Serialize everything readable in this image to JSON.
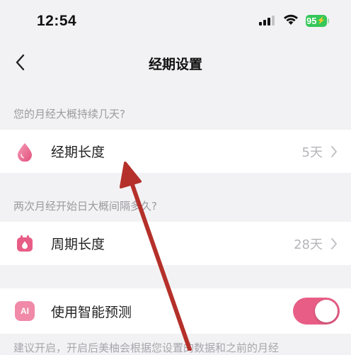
{
  "status_bar": {
    "time": "12:54",
    "battery_level": "95",
    "battery_charging_glyph": "⚡"
  },
  "nav": {
    "title": "经期设置"
  },
  "sections": {
    "period_question": "您的月经大概持续几天?",
    "cycle_question": "两次月经开始日大概间隔多久?",
    "footer_note": "建议开启，开启后美柚会根据您设置的数据和之前的月经"
  },
  "rows": {
    "period_length": {
      "label": "经期长度",
      "value": "5天"
    },
    "cycle_length": {
      "label": "周期长度",
      "value": "28天"
    },
    "smart_prediction": {
      "label": "使用智能预测",
      "icon_text": "AI",
      "enabled": true
    }
  },
  "colors": {
    "accent_pink": "#e85d86",
    "annotation_arrow": "#b5302a"
  }
}
